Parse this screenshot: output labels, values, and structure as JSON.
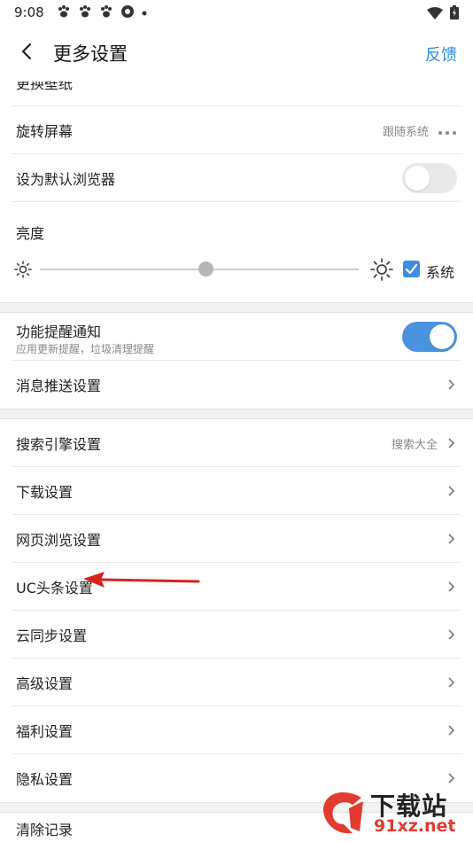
{
  "status_bar": {
    "time": "9:08",
    "notification_icons": [
      "paw-icon",
      "paw-icon",
      "paw-icon",
      "aperture-icon",
      "dot-icon"
    ],
    "right_icons": [
      "wifi-icon",
      "battery-icon"
    ]
  },
  "header": {
    "title": "更多设置",
    "feedback_label": "反馈"
  },
  "settings": {
    "wallpaper_label": "更换壁纸",
    "rotate_label": "旋转屏幕",
    "rotate_value": "跟随系统",
    "default_browser_label": "设为默认浏览器",
    "default_browser_on": false,
    "brightness_label": "亮度",
    "brightness_level": 0.52,
    "brightness_system_label": "系统",
    "brightness_system_checked": true,
    "feature_notify_label": "功能提醒通知",
    "feature_notify_sub": "应用更新提醒，垃圾清理提醒",
    "feature_notify_on": true,
    "push_label": "消息推送设置",
    "search_engine_label": "搜索引擎设置",
    "search_engine_value": "搜索大全",
    "download_label": "下载设置",
    "web_browse_label": "网页浏览设置",
    "uc_headline_label": "UC头条设置",
    "cloud_sync_label": "云同步设置",
    "advanced_label": "高级设置",
    "welfare_label": "福利设置",
    "privacy_label": "隐私设置",
    "clear_records_label": "清除记录"
  },
  "colors": {
    "accent": "#2a8ce6",
    "toggle_on": "#4a93e0",
    "annotation_arrow": "#d9231f"
  },
  "watermark": {
    "text": "下载站",
    "url": "91xz.net"
  }
}
